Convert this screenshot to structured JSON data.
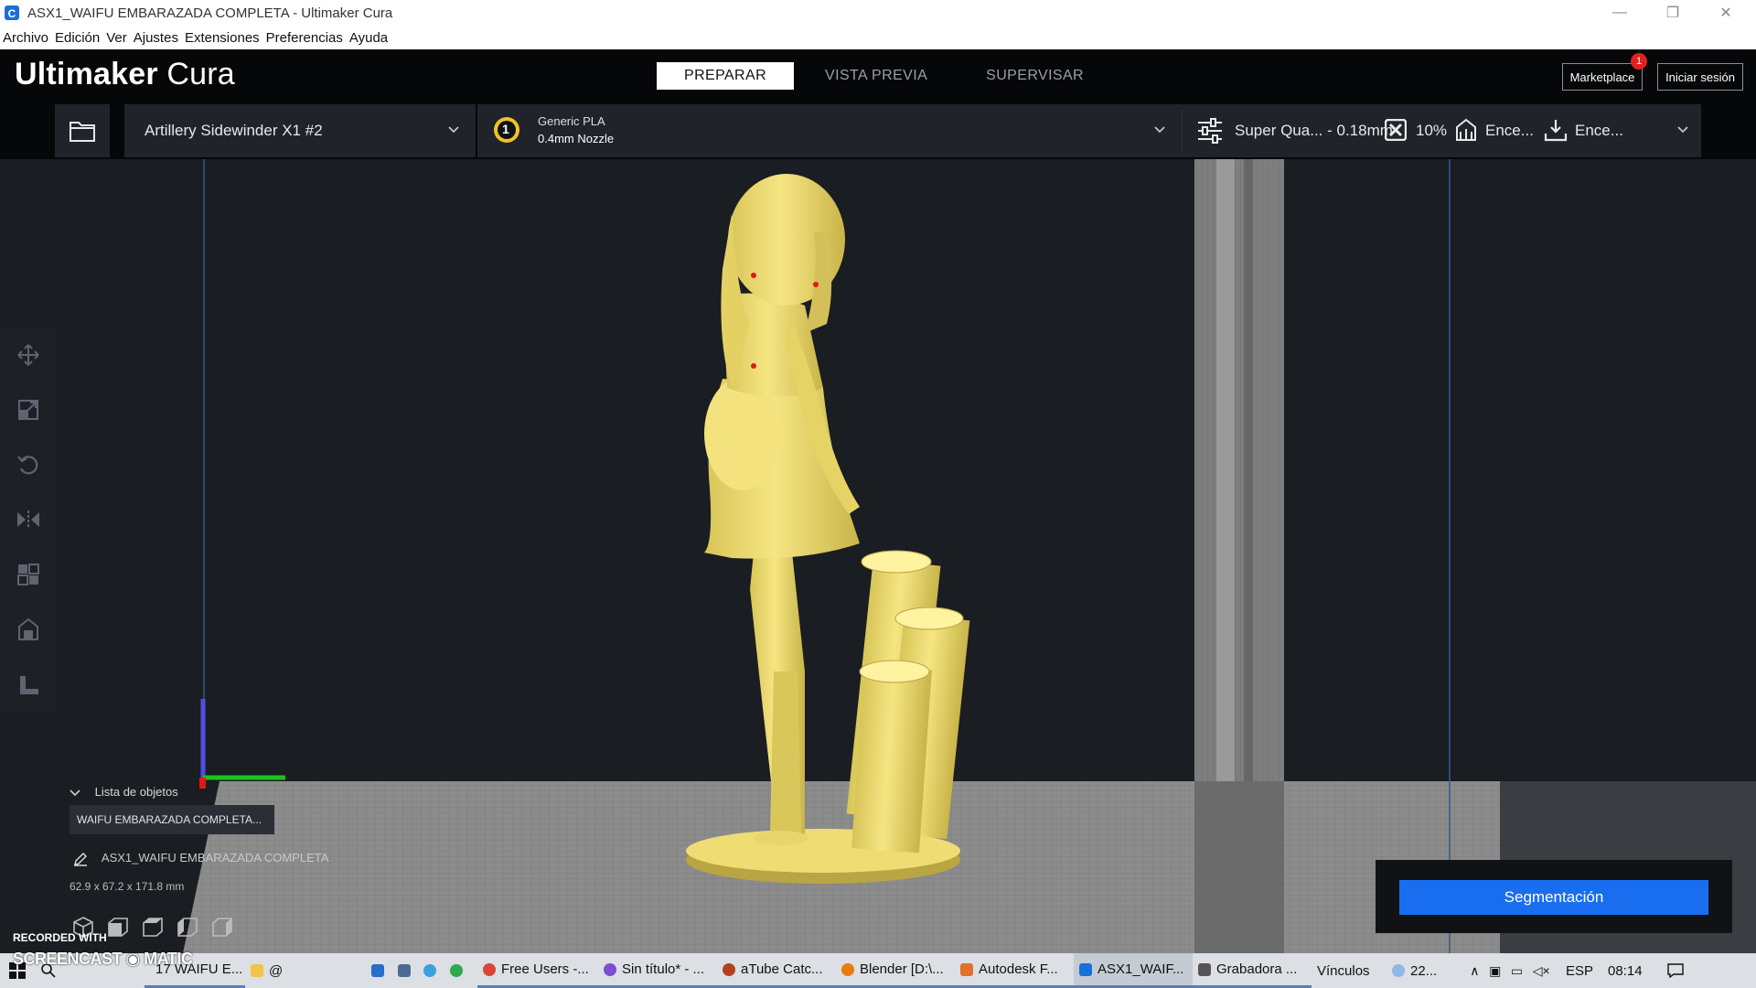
{
  "window": {
    "title": "ASX1_WAIFU EMBARAZADA COMPLETA - Ultimaker Cura",
    "minimize": "—",
    "restore": "❐",
    "close": "✕"
  },
  "menu": [
    "Archivo",
    "Edición",
    "Ver",
    "Ajustes",
    "Extensiones",
    "Preferencias",
    "Ayuda"
  ],
  "header": {
    "logo_bold": "Ultimaker",
    "logo_light": "Cura",
    "tabs": [
      "PREPARAR",
      "VISTA PREVIA",
      "SUPERVISAR"
    ],
    "active_tab": "PREPARAR",
    "marketplace": "Marketplace",
    "marketplace_badge": "1",
    "signin": "Iniciar sesión"
  },
  "toolbar": {
    "printer": "Artillery Sidewinder X1 #2",
    "extruder_number": "1",
    "material": "Generic PLA",
    "nozzle": "0.4mm Nozzle",
    "profile": "Super Qua... - 0.18mm",
    "infill": "10%",
    "support": "Ence...",
    "adhesion": "Ence..."
  },
  "objects": {
    "list_title": "Lista de objetos",
    "item": "WAIFU EMBARAZADA COMPLETA...",
    "current_name": "ASX1_WAIFU EMBARAZADA COMPLETA",
    "dimensions": "62.9 x 67.2 x 171.8 mm"
  },
  "slice": {
    "button": "Segmentación"
  },
  "watermark": {
    "line1": "RECORDED WITH",
    "line2": "SCREENCAST",
    "line3": "MATIC"
  },
  "taskbar": {
    "items": [
      "17 WAIFU E...",
      "@",
      "Free Users -...",
      "Sin título* - ...",
      "aTube Catc...",
      "Blender [D:\\...",
      "Autodesk F...",
      "ASX1_WAIF...",
      "Grabadora ..."
    ],
    "links": "Vínculos",
    "weather": "22...",
    "lang": "ESP",
    "time": "08:14"
  },
  "colors": {
    "accent": "#196ef0",
    "model": "#f2e27a",
    "header_bg": "#060708",
    "panel_bg": "#20232a"
  }
}
